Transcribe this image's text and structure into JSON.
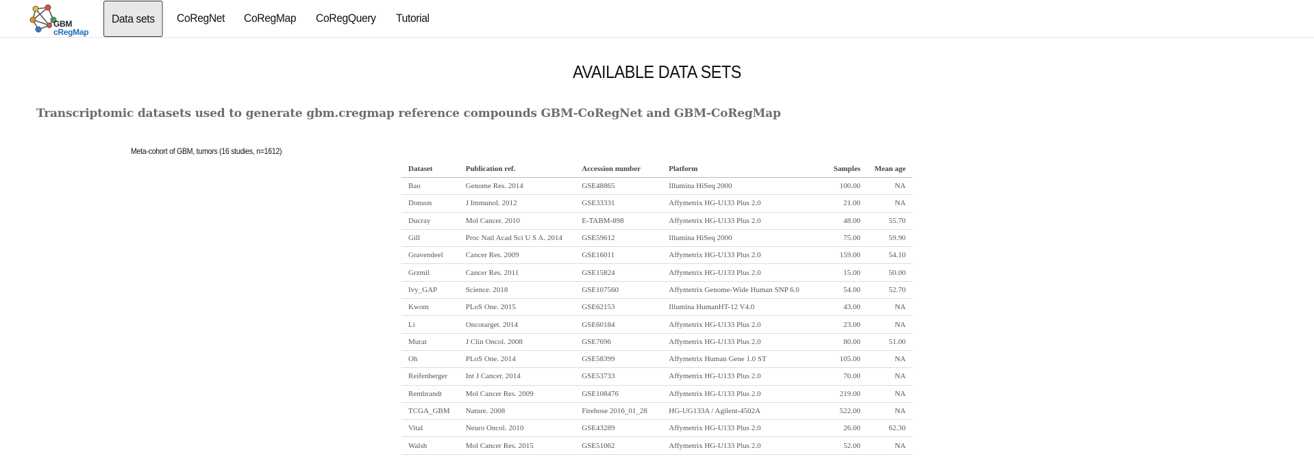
{
  "app": {
    "logo_line1": "GBM",
    "logo_line2": "cRegMap"
  },
  "nav": {
    "items": [
      {
        "label": "Data sets",
        "active": true
      },
      {
        "label": "CoRegNet",
        "active": false
      },
      {
        "label": "CoRegMap",
        "active": false
      },
      {
        "label": "CoRegQuery",
        "active": false
      },
      {
        "label": "Tutorial",
        "active": false
      }
    ]
  },
  "page": {
    "title": "AVAILABLE DATA SETS",
    "subtitle": "Transcriptomic datasets used to generate gbm.cregmap reference compounds GBM-CoRegNet and GBM-CoRegMap",
    "caption": "Meta-cohort of GBM, tumors (16 studies, n=1612)"
  },
  "table": {
    "headers": [
      "Dataset",
      "Publication ref.",
      "Accession number",
      "Platform",
      "Samples",
      "Mean age"
    ],
    "rows": [
      [
        "Bao",
        "Genome Res. 2014",
        "GSE48865",
        "Illumina HiSeq 2000",
        "100.00",
        "NA"
      ],
      [
        "Donson",
        "J Immunol. 2012",
        "GSE33331",
        "Affymetrix HG-U133 Plus 2.0",
        "21.00",
        "NA"
      ],
      [
        "Ducray",
        "Mol Cancer. 2010",
        "E-TABM-898",
        "Affymetrix HG-U133 Plus 2.0",
        "48.00",
        "55.70"
      ],
      [
        "Gill",
        "Proc Natl Acad Sci U S A. 2014",
        "GSE59612",
        "Illumina HiSeq 2000",
        "75.00",
        "59.90"
      ],
      [
        "Gravendeel",
        "Cancer Res. 2009",
        "GSE16011",
        "Affymetrix HG-U133 Plus 2.0",
        "159.00",
        "54.10"
      ],
      [
        "Grzmil",
        "Cancer Res. 2011",
        "GSE15824",
        "Affymetrix HG-U133 Plus 2.0",
        "15.00",
        "50.00"
      ],
      [
        "Ivy_GAP",
        "Science. 2018",
        "GSE107560",
        "Affymetrix Genome-Wide Human SNP 6.0",
        "54.00",
        "52.70"
      ],
      [
        "Kwom",
        "PLoS One. 2015",
        "GSE62153",
        "Illumina HumanHT-12 V4.0",
        "43.00",
        "NA"
      ],
      [
        "Li",
        "Oncotarget. 2014",
        "GSE60184",
        "Affymetrix HG-U133 Plus 2.0",
        "23.00",
        "NA"
      ],
      [
        "Murat",
        "J Clin Oncol. 2008",
        "GSE7696",
        "Affymetrix HG-U133 Plus 2.0",
        "80.00",
        "51.00"
      ],
      [
        "Oh",
        "PLoS One. 2014",
        "GSE58399",
        "Affymetrix Human Gene 1.0 ST",
        "105.00",
        "NA"
      ],
      [
        "Reifenberger",
        "Int J Cancer. 2014",
        "GSE53733",
        "Affymetrix HG-U133 Plus 2.0",
        "70.00",
        "NA"
      ],
      [
        "Rembrandt",
        "Mol Cancer Res. 2009",
        "GSE108476",
        "Affymetrix HG-U133 Plus 2.0",
        "219.00",
        "NA"
      ],
      [
        "TCGA_GBM",
        "Nature. 2008",
        "Firehose 2016_01_28",
        "HG-UG133A / Agilent-4502A",
        "522.00",
        "NA"
      ],
      [
        "Vital",
        "Neuro Oncol. 2010",
        "GSE43289",
        "Affymetrix HG-U133 Plus 2.0",
        "26.00",
        "62.30"
      ],
      [
        "Walsh",
        "Mol Cancer Res. 2015",
        "GSE51062",
        "Affymetrix HG-U133 Plus 2.0",
        "52.00",
        "NA"
      ]
    ]
  },
  "colors": {
    "nav_active_bg": "#e7e7e7",
    "subtitle": "#6d6d6d",
    "logo_blue": "#1f6fb5"
  }
}
